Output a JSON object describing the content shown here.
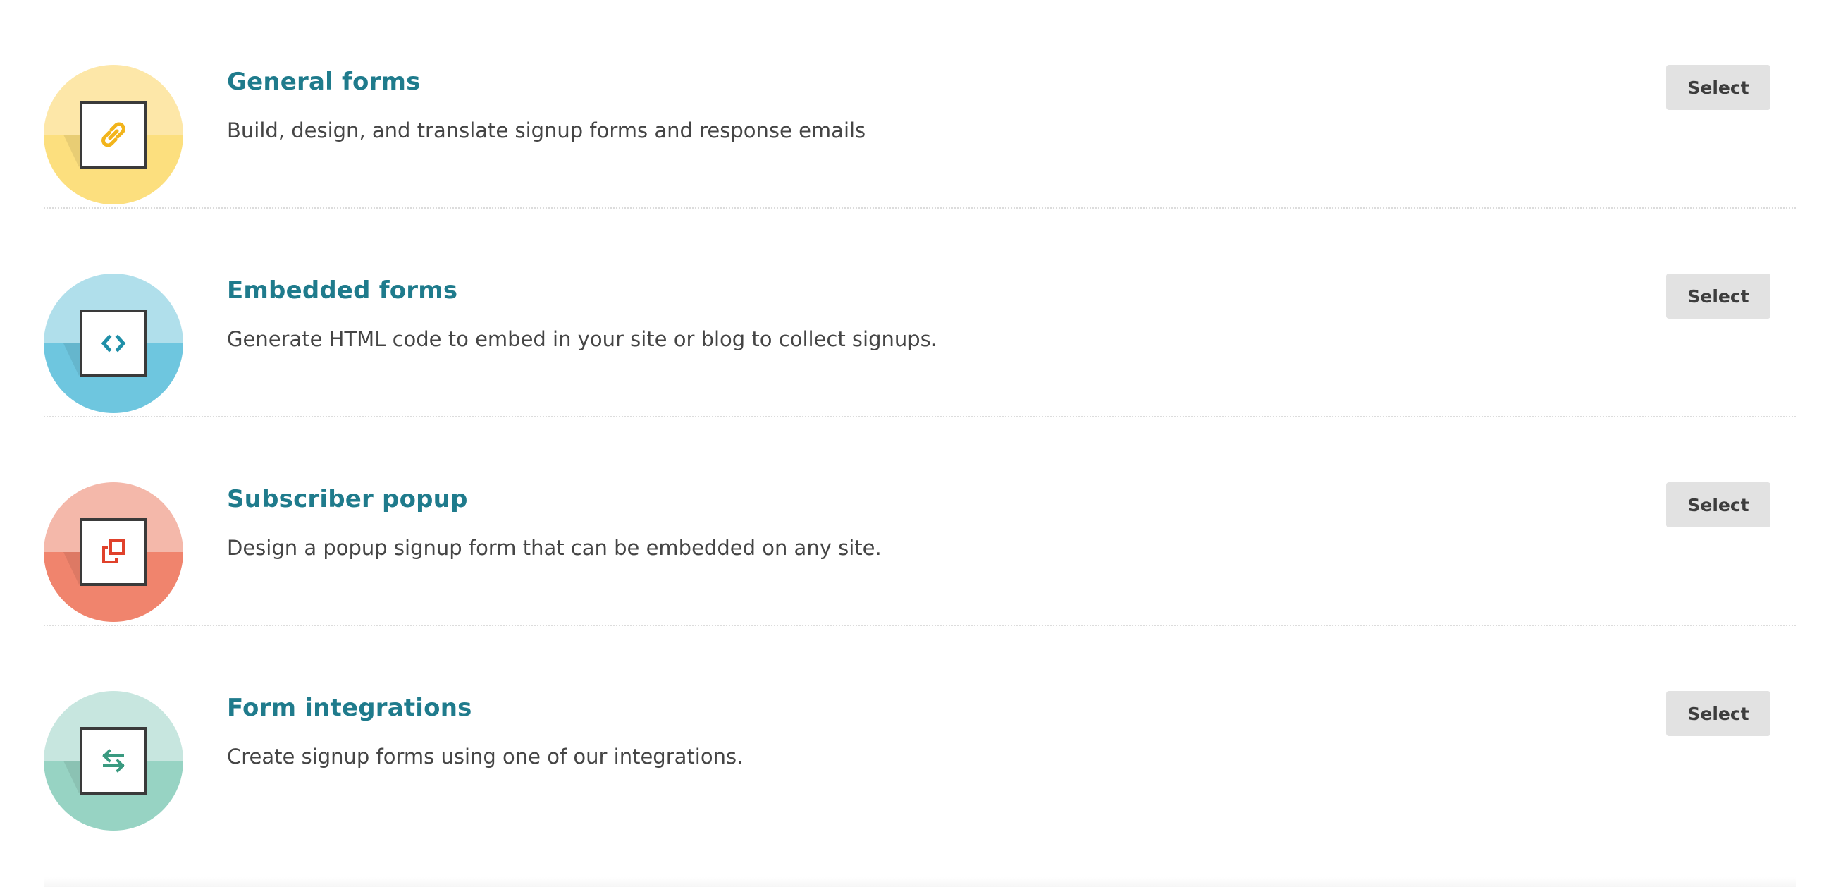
{
  "items": [
    {
      "title": "General forms",
      "description": "Build, design, and translate signup forms and response emails",
      "button_label": "Select",
      "icon": "link-icon",
      "colors": {
        "light": "#fde7a8",
        "dark": "#fcdf7e",
        "icon": "#f2b41b"
      }
    },
    {
      "title": "Embedded forms",
      "description": "Generate HTML code to embed in your site or blog to collect signups.",
      "button_label": "Select",
      "icon": "code-icon",
      "colors": {
        "light": "#b0dfeb",
        "dark": "#6ec6df",
        "icon": "#1f8fa8"
      }
    },
    {
      "title": "Subscriber popup",
      "description": "Design a popup signup form that can be embedded on any site.",
      "button_label": "Select",
      "icon": "popup-icon",
      "colors": {
        "light": "#f4b8aa",
        "dark": "#f0846d",
        "icon": "#e0412b"
      }
    },
    {
      "title": "Form integrations",
      "description": "Create signup forms using one of our integrations.",
      "button_label": "Select",
      "icon": "swap-arrows-icon",
      "colors": {
        "light": "#c7e6df",
        "dark": "#97d3c3",
        "icon": "#3a9a80"
      }
    }
  ]
}
